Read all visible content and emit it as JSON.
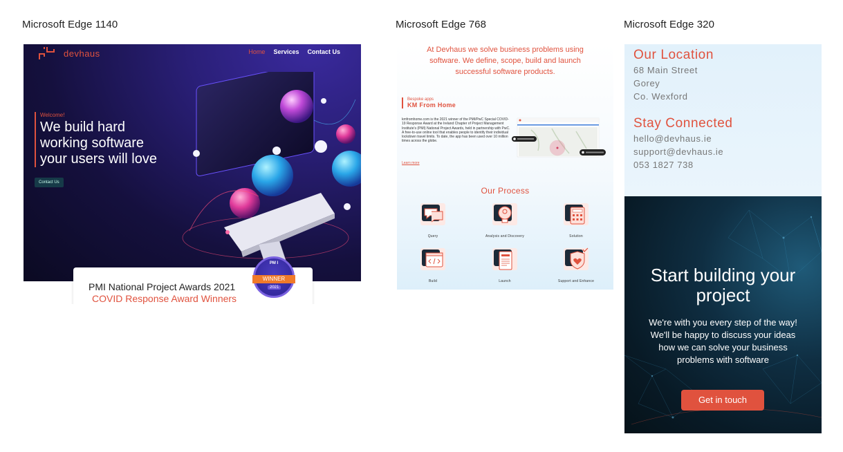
{
  "labels": {
    "edge_1140": "Microsoft Edge 1140",
    "edge_768": "Microsoft Edge 768",
    "edge_320": "Microsoft Edge 320"
  },
  "desktop": {
    "brand": "devhaus",
    "nav": [
      "Home",
      "Services",
      "Contact Us"
    ],
    "welcome": "Welcome!",
    "heading_lines": [
      "We build hard",
      "working software",
      "your users will love"
    ],
    "cta": "Contact Us",
    "award_title": "PMI National Project Awards 2021",
    "award_subtitle": "COVID Response Award Winners",
    "badge_top": "PM I",
    "badge_ribbon": "WINNER",
    "badge_year": "2021"
  },
  "tablet": {
    "intro": "At Devhaus we solve business problems using software. We define, scope, build and launch successful software products.",
    "case_kicker": "Bespoke apps",
    "case_title": "KM From Home",
    "case_body": "kmfromhome.com is the 2021 winner of the PMI/PwC Special COVID-19 Response Award at the Ireland Chapter of Project Management Institute's (PMI) National Project Awards, held in partnership with PwC. A free-to-use online tool that enables people to identify their individual lockdown travel limits. To date, the app has been used over 10 million times across the globe.",
    "case_link": "Learn more",
    "process_title": "Our Process",
    "process": [
      "Query",
      "Analysis and Discovery",
      "Solution",
      "Build",
      "Launch",
      "Support and Enhance"
    ]
  },
  "mobile": {
    "location_title": "Our Location",
    "address": [
      "68 Main Street",
      "Gorey",
      "Co. Wexford"
    ],
    "stay_title": "Stay Connected",
    "contacts": [
      "hello@devhaus.ie",
      "support@devhaus.ie",
      "053 1827 738"
    ],
    "cta_heading_lines": [
      "Start building your",
      "project"
    ],
    "cta_body_lines": [
      "We're with you every step of the way!",
      "We'll be happy to discuss your ideas",
      "how we can solve your business",
      "problems with software"
    ],
    "cta_button": "Get in touch"
  },
  "colors": {
    "accent": "#e0523e",
    "hero_bg": "#15103e",
    "cta_bg": "#0f2e42"
  }
}
